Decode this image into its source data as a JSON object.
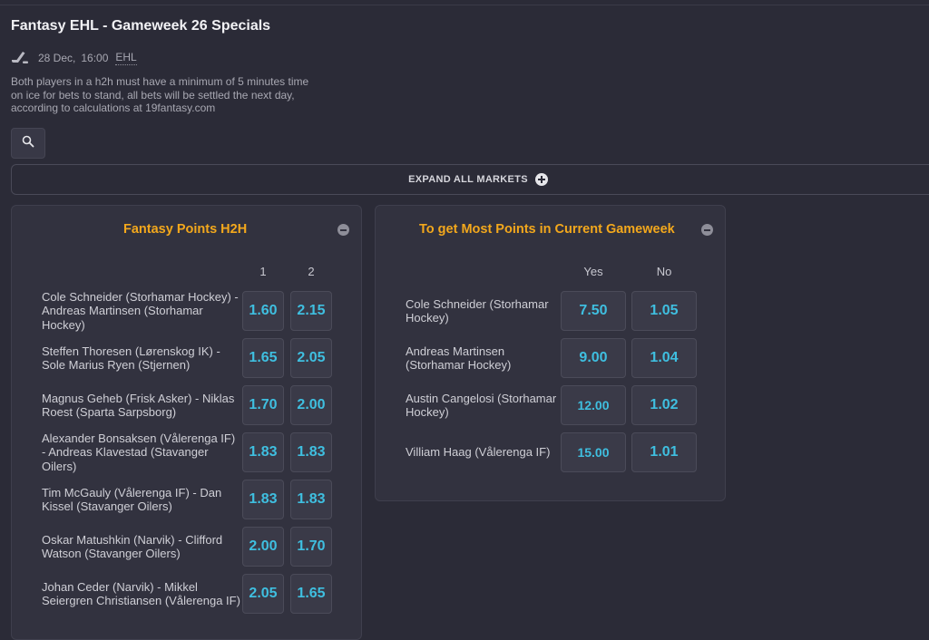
{
  "event": {
    "title": "Fantasy EHL - Gameweek 26 Specials",
    "date": "28 Dec,",
    "time": "16:00",
    "league": "EHL",
    "sport_icon": "hockey-stick-icon",
    "description": "Both players in a h2h must have a minimum of 5 minutes time on ice for bets to stand, all bets will be settled the next day, according to calculations at 19fantasy.com"
  },
  "toolbar": {
    "search_icon": "search-icon",
    "expand_label": "EXPAND ALL MARKETS",
    "expand_icon": "plus-circle-icon"
  },
  "market_h2h": {
    "title": "Fantasy Points H2H",
    "col1": "1",
    "col2": "2",
    "rows": [
      {
        "label": "Cole Schneider (Storhamar Hockey) - Andreas Martinsen (Storhamar Hockey)",
        "odd1": "1.60",
        "odd2": "2.15"
      },
      {
        "label": "Steffen Thoresen (Lørenskog IK) - Sole Marius Ryen (Stjernen)",
        "odd1": "1.65",
        "odd2": "2.05"
      },
      {
        "label": "Magnus Geheb (Frisk Asker) - Niklas Roest (Sparta Sarpsborg)",
        "odd1": "1.70",
        "odd2": "2.00"
      },
      {
        "label": "Alexander Bonsaksen (Vålerenga IF) - Andreas Klavestad (Stavanger Oilers)",
        "odd1": "1.83",
        "odd2": "1.83"
      },
      {
        "label": "Tim McGauly (Vålerenga IF) - Dan Kissel (Stavanger Oilers)",
        "odd1": "1.83",
        "odd2": "1.83"
      },
      {
        "label": "Oskar Matushkin (Narvik) - Clifford Watson (Stavanger Oilers)",
        "odd1": "2.00",
        "odd2": "1.70"
      },
      {
        "label": "Johan Ceder (Narvik) - Mikkel Seiergren Christiansen (Vålerenga IF)",
        "odd1": "2.05",
        "odd2": "1.65"
      }
    ]
  },
  "market_most": {
    "title": "To get Most Points in Current Gameweek",
    "col_yes": "Yes",
    "col_no": "No",
    "rows": [
      {
        "label": "Cole Schneider (Storhamar Hockey)",
        "yes": "7.50",
        "no": "1.05"
      },
      {
        "label": "Andreas Martinsen (Storhamar Hockey)",
        "yes": "9.00",
        "no": "1.04"
      },
      {
        "label": "Austin Cangelosi (Storhamar Hockey)",
        "yes": "12.00",
        "no": "1.02"
      },
      {
        "label": "Villiam Haag (Vålerenga IF)",
        "yes": "15.00",
        "no": "1.01"
      }
    ]
  }
}
